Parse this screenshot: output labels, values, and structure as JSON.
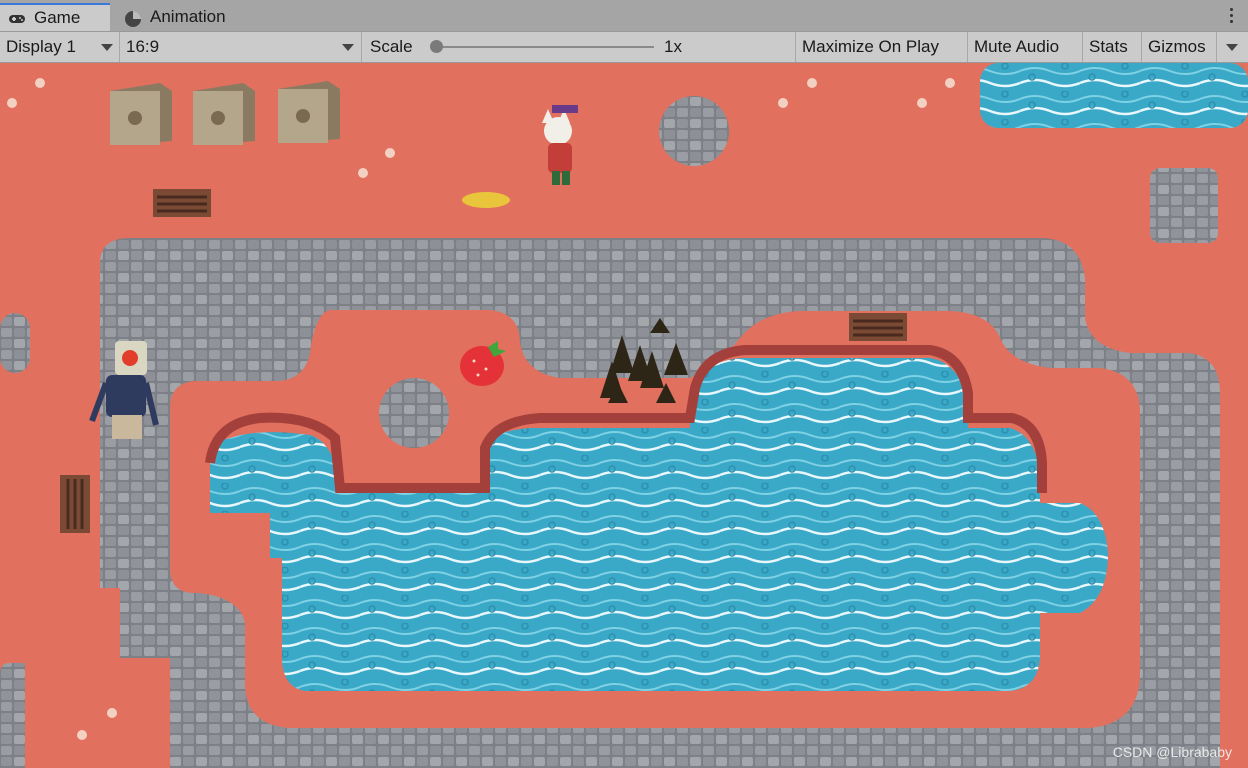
{
  "tabs": [
    {
      "label": "Game",
      "icon": "gamepad-icon",
      "active": true
    },
    {
      "label": "Animation",
      "icon": "animation-clock-icon",
      "active": false
    }
  ],
  "toolbar": {
    "display": "Display 1",
    "aspect": "16:9",
    "scale_label": "Scale",
    "scale_value": "1x",
    "maximize": "Maximize On Play",
    "mute": "Mute Audio",
    "stats": "Stats",
    "gizmos": "Gizmos"
  },
  "watermark": "CSDN @Librababy",
  "colors": {
    "ground": "#e2705e",
    "stone": "#8c8f95",
    "water": "#39a9c9",
    "accent_tab": "#3a79d8"
  }
}
